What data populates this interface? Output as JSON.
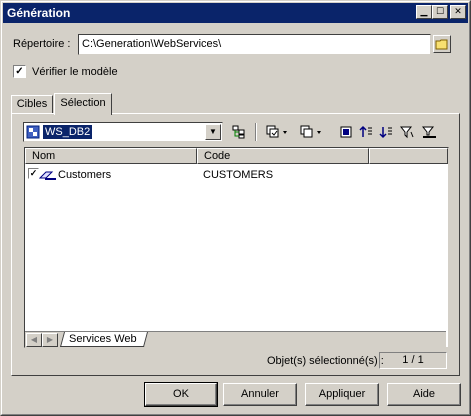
{
  "window": {
    "title": "Génération",
    "minimize_icon": "minimize-icon",
    "maximize_icon": "maximize-icon",
    "close_icon": "close-icon"
  },
  "directory": {
    "label": "Répertoire :",
    "value": "C:\\Generation\\WebServices\\",
    "browse_icon": "folder-icon"
  },
  "check_model": {
    "label": "Vérifier le modèle",
    "checked": true
  },
  "tabs": [
    {
      "label": "Cibles",
      "active": false
    },
    {
      "label": "Sélection",
      "active": true
    }
  ],
  "selection": {
    "model_select": {
      "value": "WS_DB2",
      "icon": "model-icon"
    },
    "toolbar_icons": [
      "hierarchy-icon",
      "select-all-icon",
      "deselect-all-icon",
      "move-selected-to-top-icon",
      "move-selected-to-bottom-icon",
      "filter-icon",
      "clear-filter-icon"
    ],
    "columns": [
      "Nom",
      "Code"
    ],
    "rows": [
      {
        "checked": true,
        "icon": "web-service-icon",
        "name": "Customers",
        "code": "CUSTOMERS"
      }
    ],
    "bottom_tab": "Services Web",
    "status_label": "Objet(s) sélectionné(s) :",
    "status_value": "1 / 1"
  },
  "buttons": {
    "ok": "OK",
    "cancel": "Annuler",
    "apply": "Appliquer",
    "help": "Aide"
  }
}
